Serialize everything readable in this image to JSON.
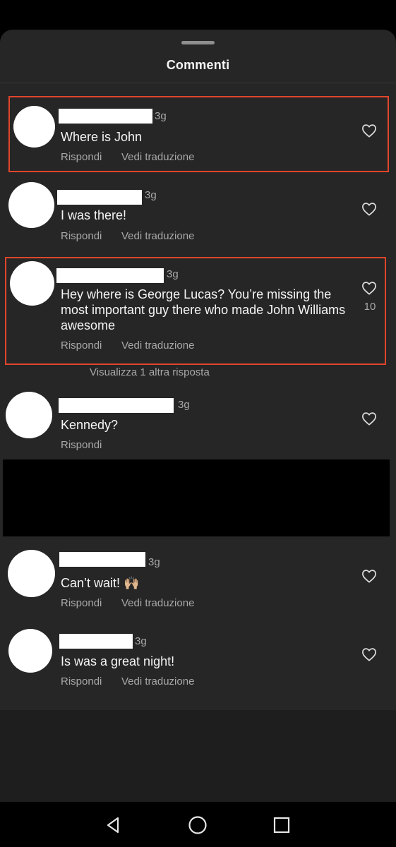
{
  "sheet": {
    "title": "Commenti"
  },
  "comments": [
    {
      "time": "3g",
      "text": "Where is John",
      "reply_label": "Rispondi",
      "translate_label": "Vedi traduzione",
      "highlighted": true
    },
    {
      "time": "3g",
      "text": "I was there!",
      "reply_label": "Rispondi",
      "translate_label": "Vedi traduzione",
      "highlighted": false
    },
    {
      "time": "3g",
      "text": "Hey where is George Lucas? You’re missing the most important guy there who made John Williams awesome",
      "reply_label": "Rispondi",
      "translate_label": "Vedi traduzione",
      "likes": "10",
      "highlighted": true,
      "more_replies": "Visualizza 1 altra risposta"
    },
    {
      "time": "3g",
      "text": "Kennedy?",
      "reply_label": "Rispondi",
      "highlighted": false
    },
    {
      "time": "3g",
      "text": "Can’t wait! 🙌🏼",
      "reply_label": "Rispondi",
      "translate_label": "Vedi traduzione",
      "highlighted": false
    },
    {
      "time": "3g",
      "text": "Is was a great night!",
      "reply_label": "Rispondi",
      "translate_label": "Vedi traduzione",
      "highlighted": false
    }
  ],
  "colors": {
    "sheet_background": "#262626",
    "highlight_border": "#e0452b",
    "secondary_text": "#a8a8a8"
  },
  "icons": {
    "like": "heart-outline-icon",
    "nav_back": "triangle-back-icon",
    "nav_home": "circle-home-icon",
    "nav_recents": "square-recents-icon"
  }
}
